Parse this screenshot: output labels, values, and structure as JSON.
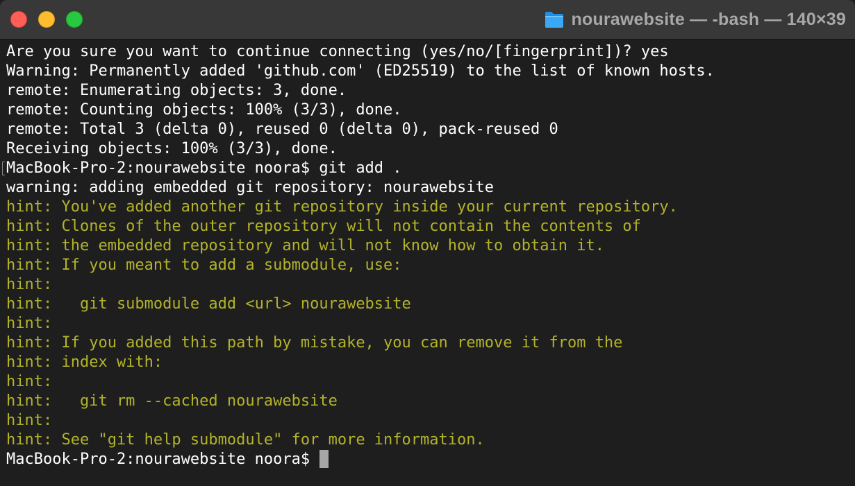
{
  "window": {
    "title": "nourawebsite — -bash — 140×39",
    "folder_icon": "folder-icon",
    "colors": {
      "close": "#ff5f57",
      "minimize": "#febc2e",
      "zoom": "#28c840",
      "background": "#1e1e1e",
      "titlebar": "#383838",
      "hint_text": "#b3b32a",
      "normal_text": "#ffffff"
    }
  },
  "terminal": {
    "lines": [
      {
        "text": "Are you sure you want to continue connecting (yes/no/[fingerprint])? yes",
        "style": "normal"
      },
      {
        "text": "Warning: Permanently added 'github.com' (ED25519) to the list of known hosts.",
        "style": "normal"
      },
      {
        "text": "remote: Enumerating objects: 3, done.",
        "style": "normal"
      },
      {
        "text": "remote: Counting objects: 100% (3/3), done.",
        "style": "normal"
      },
      {
        "text": "remote: Total 3 (delta 0), reused 0 (delta 0), pack-reused 0",
        "style": "normal"
      },
      {
        "text": "Receiving objects: 100% (3/3), done.",
        "style": "normal"
      },
      {
        "text": "MacBook-Pro-2:nourawebsite noora$ git add .",
        "style": "normal",
        "marked": true
      },
      {
        "text": "warning: adding embedded git repository: nourawebsite",
        "style": "normal"
      },
      {
        "text": "hint: You've added another git repository inside your current repository.",
        "style": "hint"
      },
      {
        "text": "hint: Clones of the outer repository will not contain the contents of",
        "style": "hint"
      },
      {
        "text": "hint: the embedded repository and will not know how to obtain it.",
        "style": "hint"
      },
      {
        "text": "hint: If you meant to add a submodule, use:",
        "style": "hint"
      },
      {
        "text": "hint:",
        "style": "hint"
      },
      {
        "text": "hint:   git submodule add <url> nourawebsite",
        "style": "hint"
      },
      {
        "text": "hint:",
        "style": "hint"
      },
      {
        "text": "hint: If you added this path by mistake, you can remove it from the",
        "style": "hint"
      },
      {
        "text": "hint: index with:",
        "style": "hint"
      },
      {
        "text": "hint:",
        "style": "hint"
      },
      {
        "text": "hint:   git rm --cached nourawebsite",
        "style": "hint"
      },
      {
        "text": "hint:",
        "style": "hint"
      },
      {
        "text": "hint: See \"git help submodule\" for more information.",
        "style": "hint"
      }
    ],
    "prompt": "MacBook-Pro-2:nourawebsite noora$ "
  }
}
